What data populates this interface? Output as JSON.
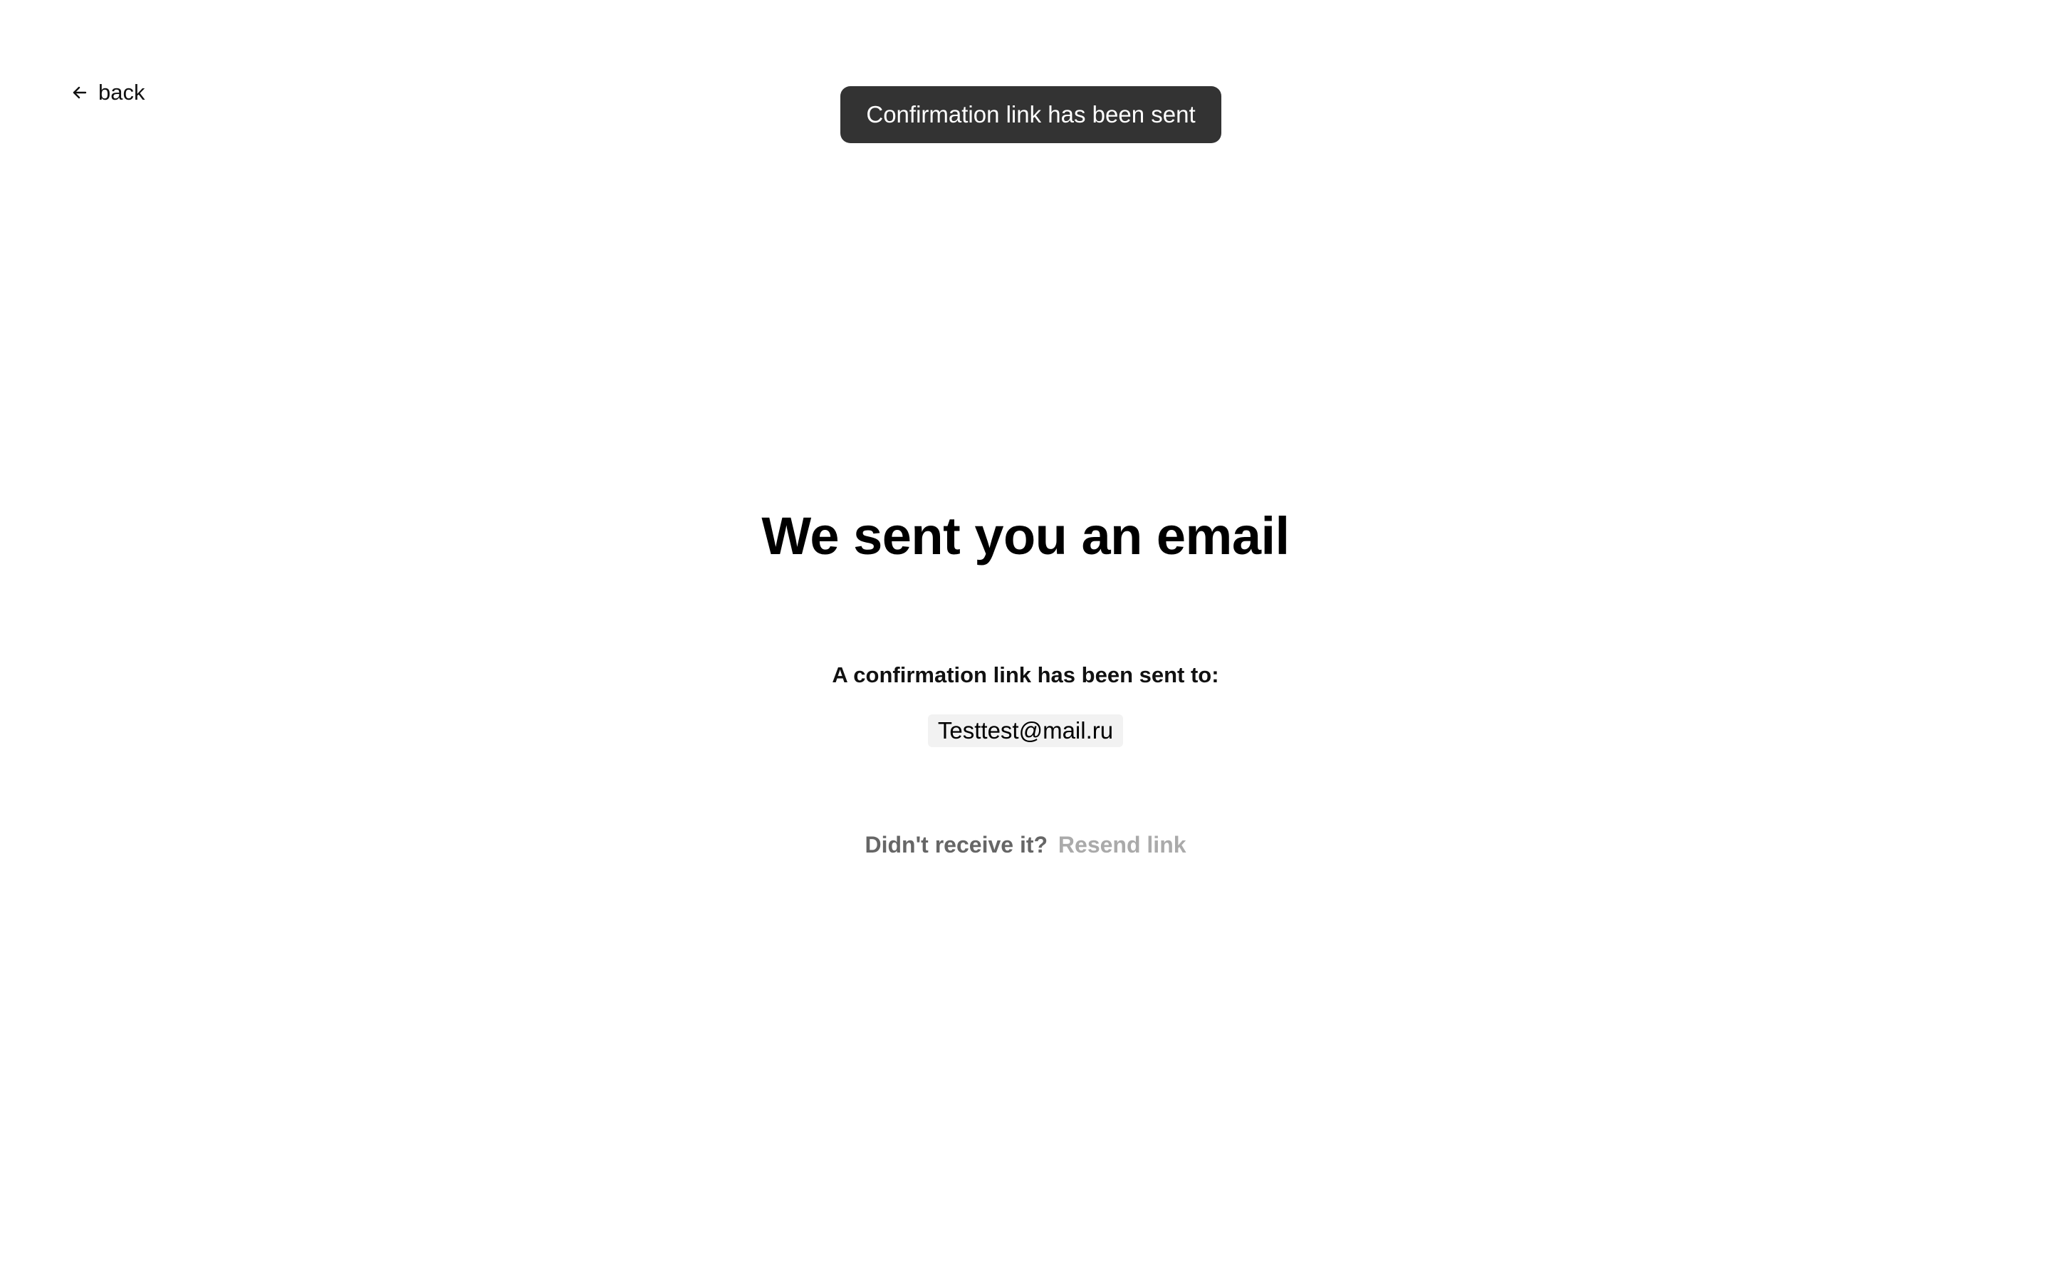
{
  "nav": {
    "back_label": "back",
    "back_icon": "arrow-left-icon"
  },
  "toast": {
    "message": "Confirmation link has been sent",
    "background": "#333333"
  },
  "main": {
    "title": "We sent you an email",
    "subtitle": "A confirmation link has been sent to:",
    "email": "Testtest@mail.ru",
    "resend_prompt": "Didn't receive it?",
    "resend_link": "Resend link"
  },
  "colors": {
    "text": "#000000",
    "muted": "#666666",
    "disabled_link": "#aaaaaa",
    "email_chip_bg": "#f2f2f2"
  }
}
